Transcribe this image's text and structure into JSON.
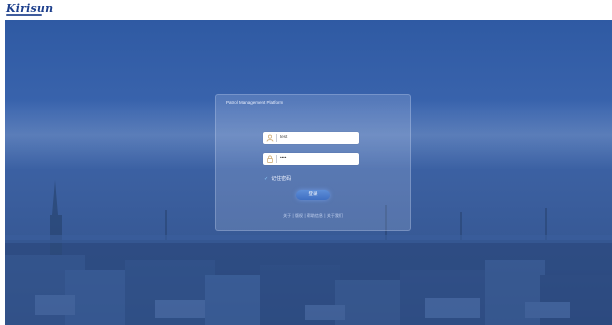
{
  "brand": {
    "logo_text": "Kirisun"
  },
  "login": {
    "title": "Patrol Management Platform",
    "username_value": "test",
    "password_value": "••••",
    "remember_label": "记住密码",
    "submit_label": "登录",
    "footer_text": "关于 | 版权 | 帮助信息 | 关于我们"
  },
  "icons": {
    "username": "user-icon",
    "password": "lock-icon",
    "remember": "check-icon"
  },
  "colors": {
    "brand": "#1d3f8c",
    "overlay": "#3a64ad",
    "button": "#4b7bcc"
  }
}
